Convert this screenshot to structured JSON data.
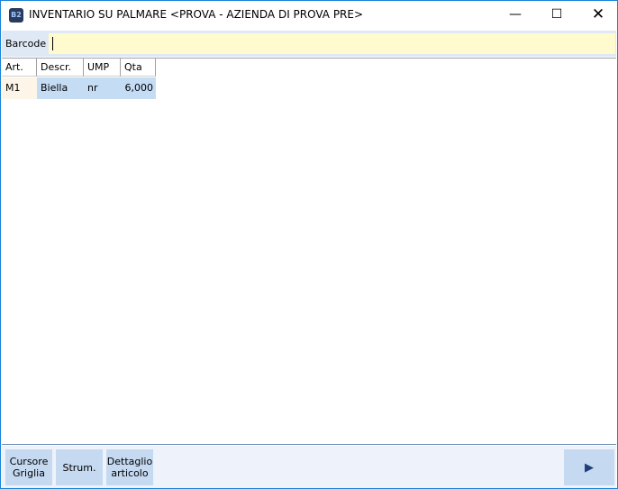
{
  "window": {
    "title": "INVENTARIO SU PALMARE <PROVA - AZIENDA DI PROVA PRE>",
    "logo": "B2"
  },
  "barcode": {
    "label": "Barcode",
    "value": ""
  },
  "grid": {
    "columns": [
      "Art.",
      "Descr.",
      "UMP",
      "Qta"
    ],
    "rows": [
      [
        "M1",
        "Biella",
        "nr",
        "6,000"
      ]
    ]
  },
  "footer": {
    "buttons": [
      "Cursore\nGriglia",
      "Strum.",
      "Dettaglio\narticolo"
    ],
    "next_icon": "play-right-icon"
  }
}
